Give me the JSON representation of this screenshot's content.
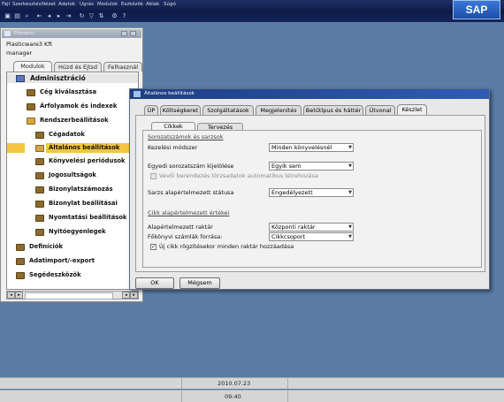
{
  "menubar": {
    "items": [
      "Fájl",
      "Szerkesztés",
      "Nézet",
      "Adatok",
      "Ugrás",
      "Modulok",
      "Eszközök",
      "Ablak",
      "Súgó"
    ]
  },
  "toolbar": {
    "icons": [
      "save-icon",
      "print-icon",
      "find-icon",
      "first-icon",
      "prev-icon",
      "next-icon",
      "last-icon",
      "refresh-icon",
      "filter-icon",
      "sort-icon",
      "settings-icon",
      "help-icon"
    ],
    "sap_logo": "SAP"
  },
  "left_window": {
    "title": "Főmenü",
    "company": "Plasticware3 Kft",
    "user": "manager",
    "tabs": [
      "Modulok",
      "Húzd és Ejtsd",
      "Felhasznál"
    ],
    "tree": {
      "root": "Adminisztráció",
      "items": [
        {
          "label": "Cég kiválasztása",
          "level": 1,
          "type": "folder"
        },
        {
          "label": "Árfolyamok és indexek",
          "level": 1,
          "type": "folder"
        },
        {
          "label": "Rendszerbeállítások",
          "level": 1,
          "type": "folder-open"
        },
        {
          "label": "Cégadatok",
          "level": 2,
          "type": "folder"
        },
        {
          "label": "Általános beállítások",
          "level": 2,
          "type": "folder-open",
          "selected": true
        },
        {
          "label": "Könyvelési periódusok",
          "level": 2,
          "type": "folder"
        },
        {
          "label": "Jogosultságok",
          "level": 2,
          "type": "folder"
        },
        {
          "label": "Bizonylatszámozás",
          "level": 2,
          "type": "folder"
        },
        {
          "label": "Bizonylat beállításai",
          "level": 2,
          "type": "folder"
        },
        {
          "label": "Nyomtatási beállítások",
          "level": 2,
          "type": "folder"
        },
        {
          "label": "Nyitóegyenlegek",
          "level": 2,
          "type": "folder"
        },
        {
          "label": "Definíciók",
          "level": 1,
          "type": "folder"
        },
        {
          "label": "Adatimport/-export",
          "level": 1,
          "type": "folder"
        },
        {
          "label": "Segédeszközök",
          "level": 1,
          "type": "folder"
        }
      ]
    }
  },
  "dialog": {
    "title": "Általános beállítások",
    "tabs": [
      "ÜP",
      "Költségkeret",
      "Szolgáltatások",
      "Megjelenítés",
      "Betűtípus és háttér",
      "Útvonal",
      "Készlet"
    ],
    "active_tab": "Készlet",
    "subtabs": [
      "Cikkek",
      "Tervezés"
    ],
    "active_subtab": "Cikkek",
    "section1": {
      "title": "Sorozatszámok és sarzsok",
      "kezelesi_label": "Kezelési módszer",
      "kezelesi_value": "Minden könyvelésnél",
      "egyedi_label": "Egyedi sorozatszám kijelölése",
      "egyedi_value": "Egyik sem",
      "checkbox1": "Vevői berendezés törzsadatok automatikus létrehozása",
      "sarzs_label": "Sarzs alapértelmezett státusa",
      "sarzs_value": "Engedélyezett"
    },
    "section2": {
      "title": "Cikk alapértelmezett értékei",
      "raktar_label": "Alapértelmezett raktár",
      "raktar_value": "Központi raktár",
      "fokonyvi_label": "Főkönyvi számlák forrása:",
      "fokonyvi_value": "Cikkcsoport",
      "checkbox2": "Új cikk rögzítésekor minden raktár hozzáadása"
    },
    "buttons": {
      "ok": "OK",
      "cancel": "Mégsem"
    }
  },
  "status": {
    "date": "2010.07.23",
    "time": "09:40"
  }
}
